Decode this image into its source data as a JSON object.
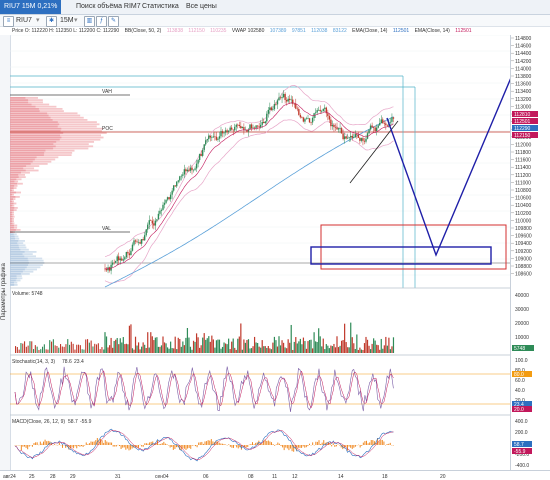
{
  "tabs": [
    {
      "label": "RIU7 15M 0,21%",
      "active": true
    },
    {
      "label": "Поиск объёма RIM7",
      "active": false
    },
    {
      "label": "Статистика",
      "active": false
    },
    {
      "label": "Все цены",
      "active": false
    }
  ],
  "toolbar": {
    "instrument": "RIU7",
    "timeframe": "15M"
  },
  "info": {
    "price": "Price O: 112220 H: 112350 L: 112200 C: 112290",
    "bb": "BB(Close, 50, 2)",
    "bb_values": [
      "113838",
      "112150",
      "110235"
    ],
    "vwap": "VWAP 102580",
    "vwap_values": [
      "107389",
      "97851",
      "112038",
      "83122"
    ],
    "ema1": "EMA(Close, 14)",
    "ema1_value": "112501",
    "ema2": "EMA(Close, 14)",
    "ema2_value": "112501"
  },
  "sidebar_label": "Параметры графика",
  "profile_labels": {
    "vah": "VAH",
    "poc": "POC",
    "val": "VAL"
  },
  "price_axis": [
    "114800",
    "114600",
    "114400",
    "114200",
    "114000",
    "113800",
    "113600",
    "113400",
    "113200",
    "113000",
    "112800",
    "112600",
    "112400",
    "112200",
    "112000",
    "111800",
    "111600",
    "111400",
    "111200",
    "111000",
    "110800",
    "110600",
    "110400",
    "110200",
    "110000",
    "109800",
    "109600",
    "109400",
    "109200",
    "109000",
    "108800",
    "108600"
  ],
  "price_badges": [
    {
      "text": "112810",
      "color": "#c2185b"
    },
    {
      "text": "112501",
      "color": "#c2185b"
    },
    {
      "text": "112290",
      "color": "#2d6fc0"
    },
    {
      "text": "112150",
      "color": "#c2185b"
    }
  ],
  "volume": {
    "label": "Volume: 5748",
    "axis": [
      "40000",
      "30000",
      "20000",
      "10000"
    ],
    "badges": [
      {
        "text": "5748",
        "color": "#2e8b57"
      }
    ]
  },
  "stochastic": {
    "label": "Stochastic(14, 3, 3)",
    "values": [
      "78.6",
      "23.4"
    ],
    "axis": [
      "100.0",
      "80.0",
      "60.0",
      "40.0",
      "20.0",
      "0.0"
    ],
    "badges": [
      {
        "text": "80.0",
        "color": "#f39c12"
      },
      {
        "text": "23.4",
        "color": "#2d6fc0"
      },
      {
        "text": "20.0",
        "color": "#c2185b"
      }
    ]
  },
  "macd": {
    "label": "MACD(Close, 26, 12, 9)",
    "values": [
      "58.7",
      "-55.9"
    ],
    "axis": [
      "400.0",
      "200.0",
      "0.0",
      "-200.0",
      "-400.0"
    ],
    "badges": [
      {
        "text": "58.7",
        "color": "#2d6fc0"
      },
      {
        "text": "-55.9",
        "color": "#c2185b"
      }
    ]
  },
  "time_axis": [
    "авг24",
    "25",
    "28",
    "29",
    "31",
    "сен04",
    "06",
    "08",
    "11",
    "12",
    "14",
    "18",
    "20"
  ],
  "colors": {
    "accent": "#2d6fc0",
    "candle_up": "#2e8b57",
    "candle_down": "#c0392b",
    "forecast": "#1f1fa8",
    "zone_red": "#d32f2f"
  }
}
